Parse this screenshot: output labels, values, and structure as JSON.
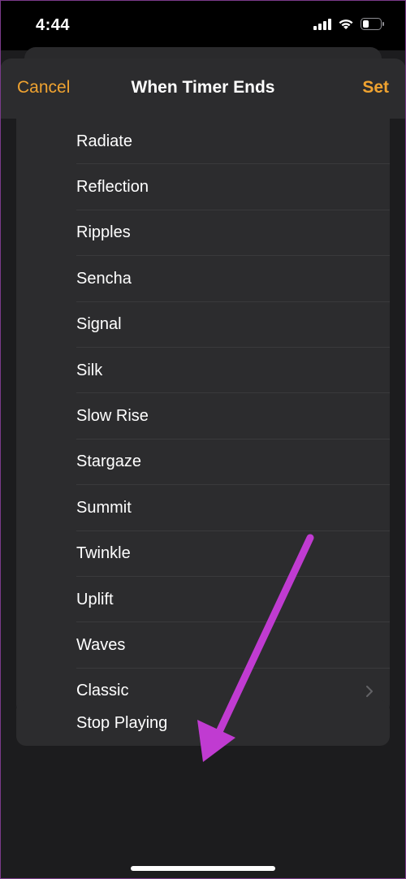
{
  "status": {
    "time": "4:44",
    "colors": {
      "accent": "#f0a330",
      "annotation": "#c03bd1"
    }
  },
  "nav": {
    "cancel": "Cancel",
    "title": "When Timer Ends",
    "set": "Set"
  },
  "sounds": [
    {
      "label": "Radiate"
    },
    {
      "label": "Reflection"
    },
    {
      "label": "Ripples"
    },
    {
      "label": "Sencha"
    },
    {
      "label": "Signal"
    },
    {
      "label": "Silk"
    },
    {
      "label": "Slow Rise"
    },
    {
      "label": "Stargaze"
    },
    {
      "label": "Summit"
    },
    {
      "label": "Twinkle"
    },
    {
      "label": "Uplift"
    },
    {
      "label": "Waves"
    },
    {
      "label": "Classic"
    }
  ],
  "stop": {
    "label": "Stop Playing"
  }
}
